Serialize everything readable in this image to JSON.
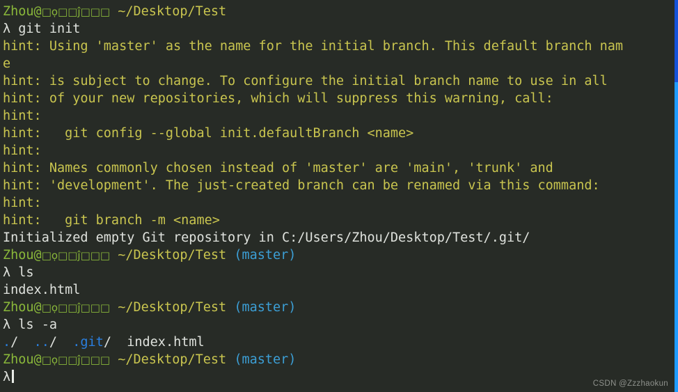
{
  "terminal": {
    "background_color": "#272b26",
    "foreground_color": "#d6d9d4",
    "colors": {
      "prompt_user_host": "#8ab83a",
      "prompt_path": "#c9c54f",
      "prompt_branch": "#3c9fd6",
      "hint_text": "#c9c54f",
      "directory": "#2a7fe0",
      "normal_text": "#d6d9d4",
      "scrollbar": "#1f9bff"
    },
    "prompt": {
      "user_host": "Zhou@",
      "host_tofu": "□ọ□□ĵ□□□",
      "path": "~/Desktop/Test",
      "branch": "(master)",
      "symbol": "λ"
    },
    "lines": [
      {
        "id": "prompt-1",
        "type": "prompt",
        "user_host": "Zhou@",
        "path": "~/Desktop/Test",
        "branch": ""
      },
      {
        "id": "cmd-git-init",
        "type": "command",
        "text": "git init"
      },
      {
        "id": "hint-1",
        "type": "hint",
        "text": "hint: Using 'master' as the name for the initial branch. This default branch nam"
      },
      {
        "id": "hint-1-wrap",
        "type": "hint",
        "text": "e"
      },
      {
        "id": "hint-2",
        "type": "hint",
        "text": "hint: is subject to change. To configure the initial branch name to use in all"
      },
      {
        "id": "hint-3",
        "type": "hint",
        "text": "hint: of your new repositories, which will suppress this warning, call:"
      },
      {
        "id": "hint-4",
        "type": "hint",
        "text": "hint:"
      },
      {
        "id": "hint-5",
        "type": "hint",
        "text": "hint:   git config --global init.defaultBranch <name>"
      },
      {
        "id": "hint-6",
        "type": "hint",
        "text": "hint:"
      },
      {
        "id": "hint-7",
        "type": "hint",
        "text": "hint: Names commonly chosen instead of 'master' are 'main', 'trunk' and"
      },
      {
        "id": "hint-8",
        "type": "hint",
        "text": "hint: 'development'. The just-created branch can be renamed via this command:"
      },
      {
        "id": "hint-9",
        "type": "hint",
        "text": "hint:"
      },
      {
        "id": "hint-10",
        "type": "hint",
        "text": "hint:   git branch -m <name>"
      },
      {
        "id": "init-result",
        "type": "output",
        "text": "Initialized empty Git repository in C:/Users/Zhou/Desktop/Test/.git/"
      },
      {
        "id": "prompt-2",
        "type": "prompt",
        "user_host": "Zhou@",
        "path": "~/Desktop/Test",
        "branch": "(master)"
      },
      {
        "id": "cmd-ls",
        "type": "command",
        "text": "ls"
      },
      {
        "id": "ls-output",
        "type": "output",
        "text": "index.html"
      },
      {
        "id": "prompt-3",
        "type": "prompt",
        "user_host": "Zhou@",
        "path": "~/Desktop/Test",
        "branch": "(master)"
      },
      {
        "id": "cmd-ls-a",
        "type": "command",
        "text": "ls -a"
      },
      {
        "id": "ls-a-output",
        "type": "file-listing",
        "entries": [
          {
            "name": ".",
            "suffix": "/",
            "kind": "directory"
          },
          {
            "name": "..",
            "suffix": "/",
            "kind": "directory"
          },
          {
            "name": ".git",
            "suffix": "/",
            "kind": "directory"
          },
          {
            "name": "index.html",
            "suffix": "",
            "kind": "file"
          }
        ]
      },
      {
        "id": "prompt-4",
        "type": "prompt",
        "user_host": "Zhou@",
        "path": "~/Desktop/Test",
        "branch": "(master)"
      },
      {
        "id": "cursor-line",
        "type": "cursor"
      }
    ]
  },
  "watermark": {
    "text": "CSDN @Zzzhaokun"
  }
}
